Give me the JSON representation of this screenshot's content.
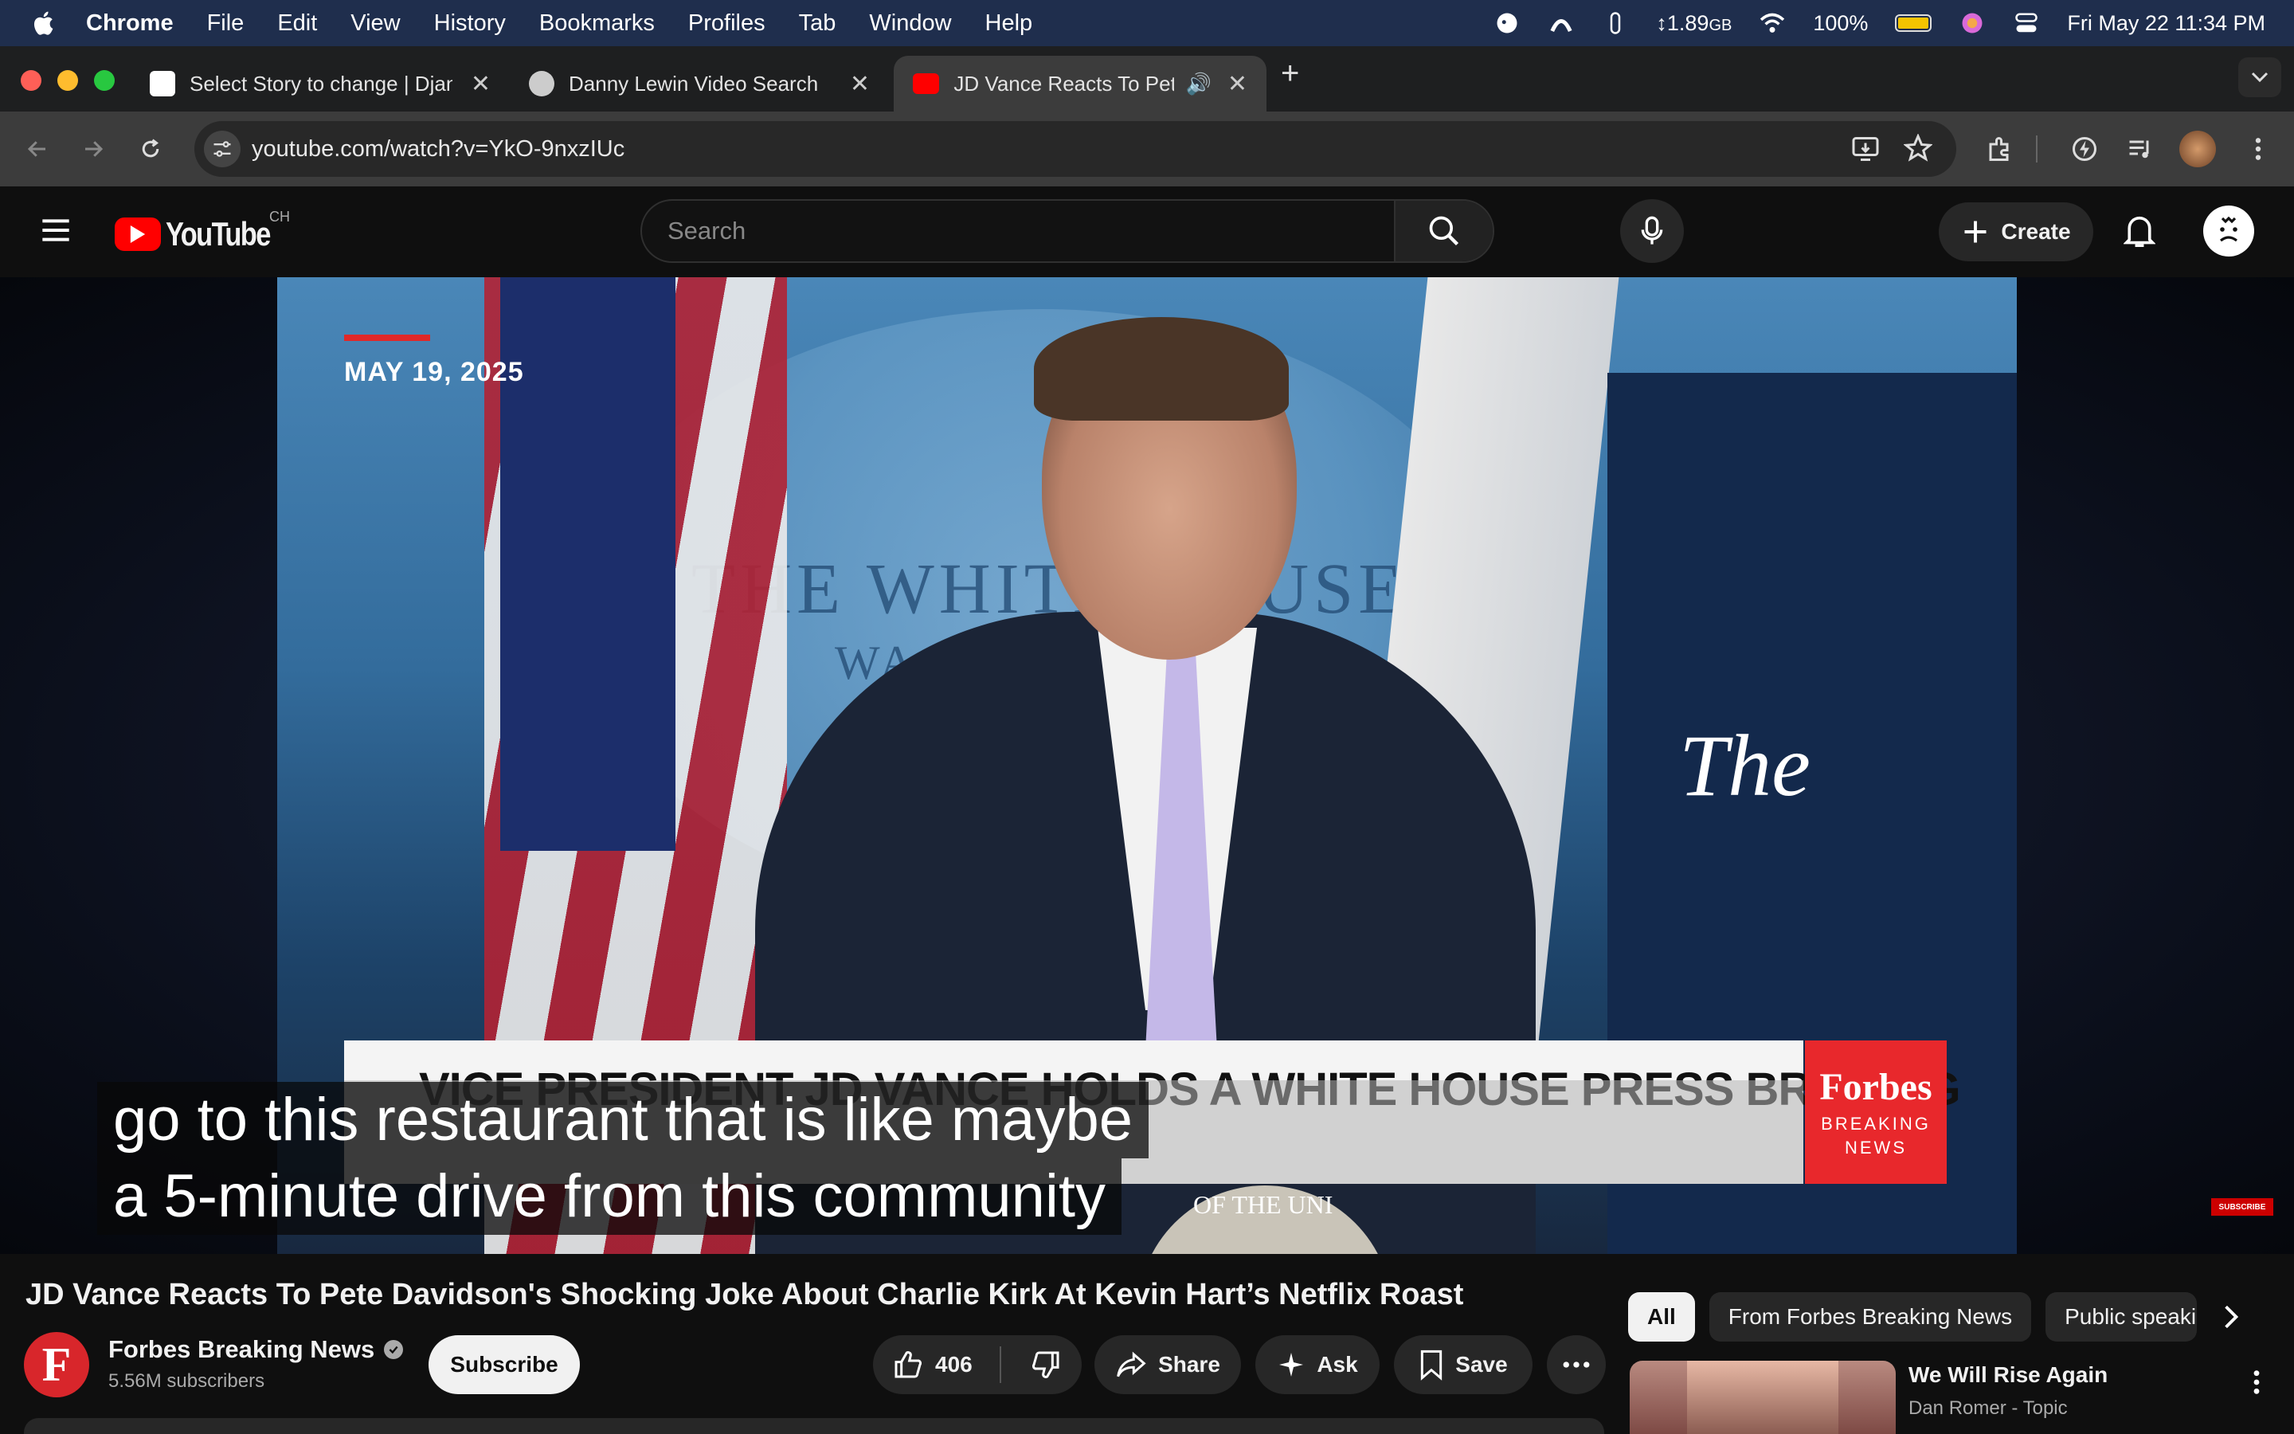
{
  "menubar": {
    "app": "Chrome",
    "items": [
      "File",
      "Edit",
      "View",
      "History",
      "Bookmarks",
      "Profiles",
      "Tab",
      "Window",
      "Help"
    ],
    "memory": "1.89",
    "memory_unit": "GB",
    "battery": "100%",
    "battery_level": 1.0,
    "datetime": "Fri May 22  11:34 PM"
  },
  "tabs": [
    {
      "title": "Select Story to change | Django",
      "active": false
    },
    {
      "title": "Danny Lewin Video Search",
      "active": false
    },
    {
      "title": "JD Vance Reacts To Pete Davidson",
      "active": true
    }
  ],
  "omnibox": {
    "url": "youtube.com/watch?v=YkO-9nxzIUc"
  },
  "youtube": {
    "logo_text": "YouTube",
    "country": "CH",
    "search_placeholder": "Search",
    "create_label": "Create"
  },
  "video": {
    "date_overlay": "MAY 19, 2025",
    "backdrop_text": "THE WHITE HOUSE",
    "backdrop_sub": "WA",
    "right_text": "The",
    "lower_third": "VICE PRESIDENT JD VANCE HOLDS A WHITE HOUSE PRESS BRIEFING",
    "forbes_logo": "Forbes",
    "forbes_sub": "BREAKING NEWS",
    "seal_text": "OF THE UNI",
    "captions": [
      "go to this restaurant that is like maybe",
      "a 5-minute drive from this community"
    ],
    "watermark": "SUBSCRIBE"
  },
  "info": {
    "title": "JD Vance Reacts To Pete Davidson's Shocking Joke About Charlie Kirk At Kevin Hart’s Netflix Roast",
    "channel": "Forbes Breaking News",
    "channel_initial": "F",
    "subscribers": "5.56M subscribers",
    "subscribe_label": "Subscribe",
    "likes": "406",
    "share_label": "Share",
    "ask_label": "Ask",
    "save_label": "Save"
  },
  "chips": [
    "All",
    "From Forbes Breaking News",
    "Public speaking"
  ],
  "recommendation": {
    "title": "We Will Rise Again",
    "channel": "Dan Romer - Topic"
  },
  "colors": {
    "yt_red": "#ff0000",
    "menubar_bg": "#1f2e4d",
    "forbes_red": "#e8282c"
  }
}
